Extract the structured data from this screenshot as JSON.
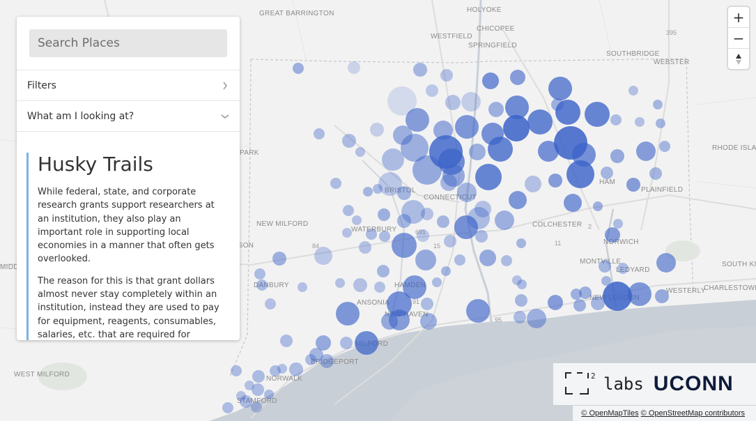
{
  "search": {
    "placeholder": "Search Places"
  },
  "accordion": {
    "filters": "Filters",
    "what": "What am I looking at?"
  },
  "panel": {
    "title": "Husky Trails",
    "paragraphs": [
      "While federal, state, and corporate research grants support researchers at an institution, they also play an important role in supporting local economies in a manner that often gets overlooked.",
      "The reason for this is that grant dollars almost never stay completely within an institution, instead they are used to pay for equipment, reagents, consumables, salaries, etc. that are required for"
    ]
  },
  "zoom": {
    "in": "+",
    "out": "−",
    "compass": "▲"
  },
  "logos": {
    "labs": "labs",
    "labs_superscript": "2",
    "uconn": "UCONN"
  },
  "attribution": {
    "tiles": "© OpenMapTiles",
    "osm": "© OpenStreetMap contributors"
  },
  "map_labels": [
    "GREAT BARRINGTON",
    "HOLYOKE",
    "CHICOPEE",
    "WESTFIELD",
    "SPRINGFIELD",
    "395",
    "SOUTHBRIDGE",
    "WEBSTER",
    "PARK",
    "RHODE ISLAND",
    "BRISTOL",
    "CONNECTICUT",
    "PLAINFIELD",
    "NEW MILFORD",
    "PATTERSON",
    "WATERBURY",
    "691",
    "COLCHESTER",
    "NORWICH",
    "MIDDLETOWN",
    "15",
    "MONTVILLE",
    "LEDYARD",
    "SOUTH KING",
    "DANBURY",
    "HAMDEN",
    "NEW LONDON",
    "WESTERLY",
    "CHARLESTOWN",
    "ANSONIA",
    "91",
    "NEW HAVEN",
    "95",
    "MILFORD",
    "BRIDGEPORT",
    "WEST MILFORD",
    "NORWALK",
    "STAMFORD",
    "2",
    "11",
    "84",
    "HAM"
  ],
  "colors": {
    "bubble": "#3a62c8",
    "water": "#c9cfd6",
    "accent": "#7cb3e6"
  }
}
